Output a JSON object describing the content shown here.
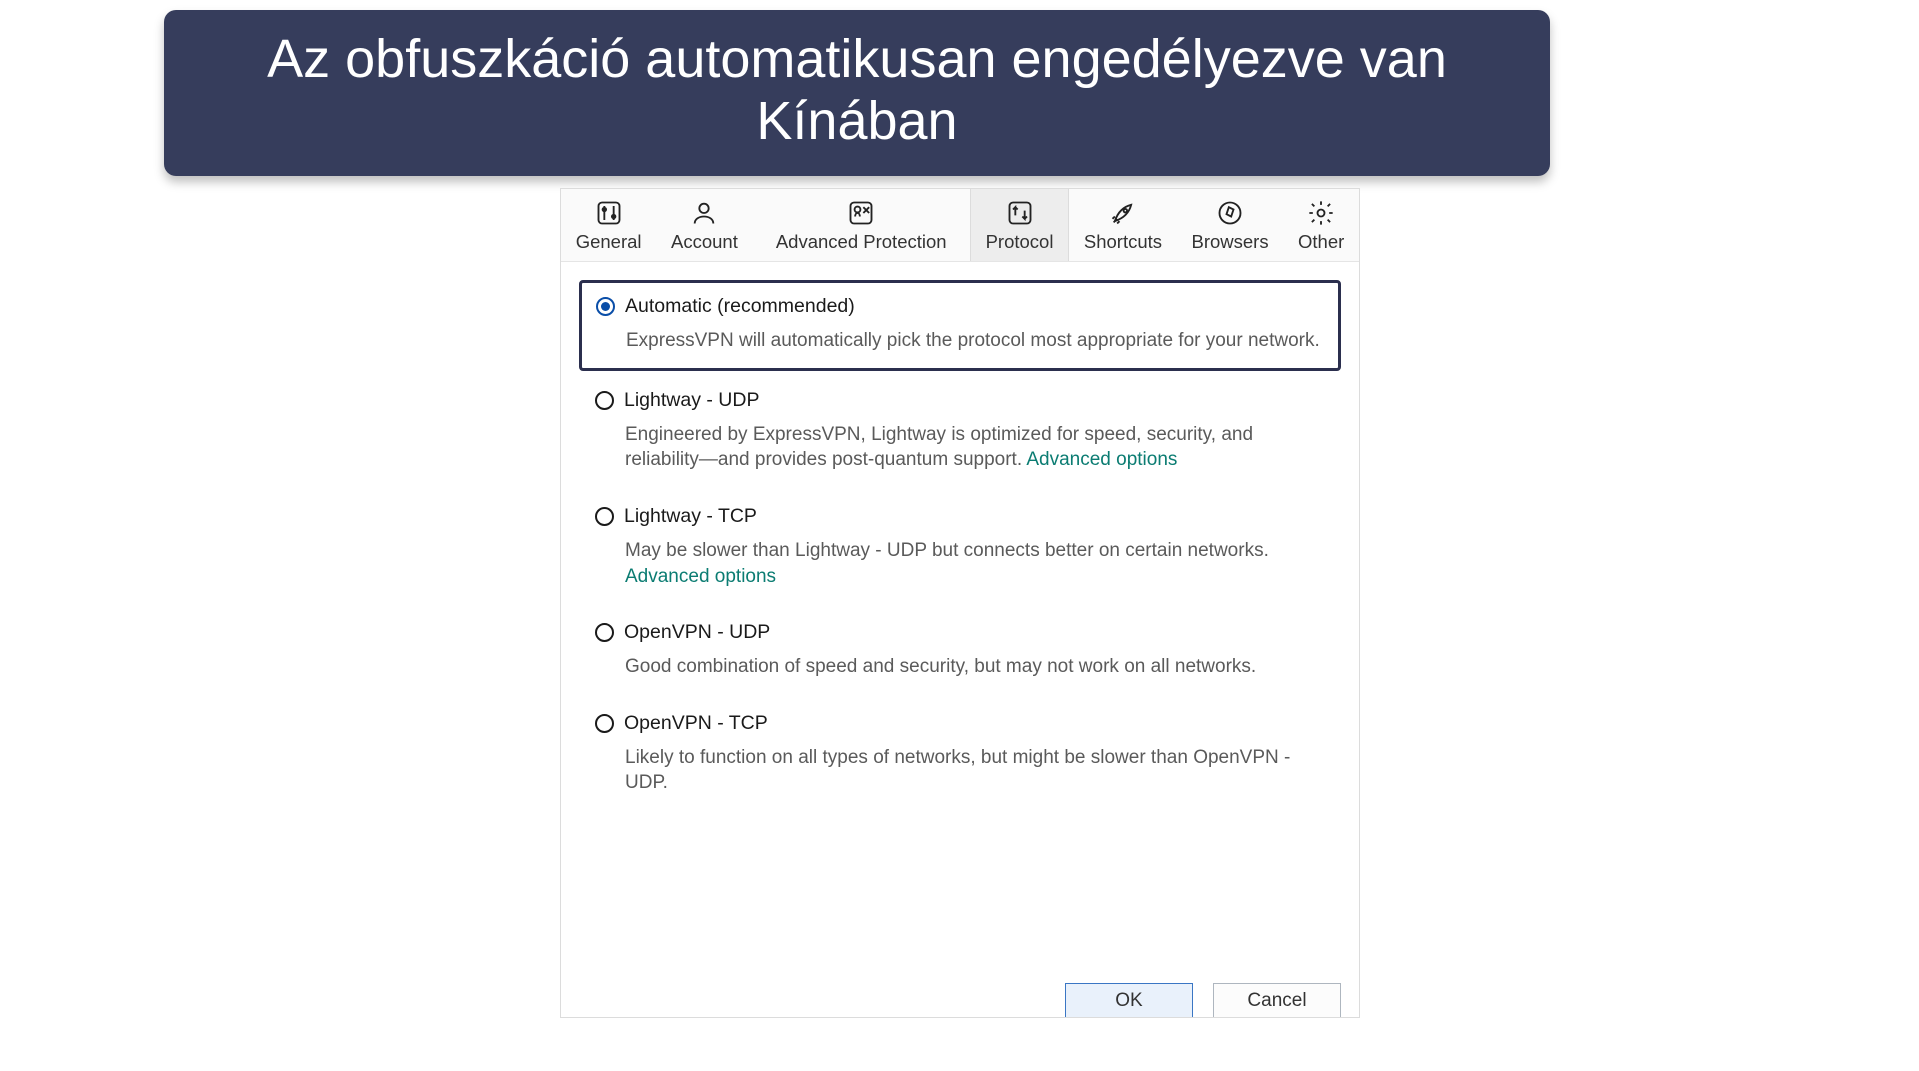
{
  "banner": {
    "text": "Az obfuszkáció automatikusan engedélyezve van Kínában"
  },
  "tabs": [
    {
      "id": "general",
      "label": "General"
    },
    {
      "id": "account",
      "label": "Account"
    },
    {
      "id": "advprot",
      "label": "Advanced Protection"
    },
    {
      "id": "protocol",
      "label": "Protocol",
      "active": true
    },
    {
      "id": "shortcuts",
      "label": "Shortcuts"
    },
    {
      "id": "browsers",
      "label": "Browsers"
    },
    {
      "id": "other",
      "label": "Other"
    }
  ],
  "protocols": {
    "automatic": {
      "title": "Automatic (recommended)",
      "desc": "ExpressVPN will automatically pick the protocol most appropriate for your network.",
      "selected": true
    },
    "lightway_udp": {
      "title": "Lightway - UDP",
      "desc_before": "Engineered by ExpressVPN, Lightway is optimized for speed, security, and reliability—and provides post-quantum support. ",
      "link": "Advanced options"
    },
    "lightway_tcp": {
      "title": "Lightway - TCP",
      "desc_before": "May be slower than Lightway - UDP but connects better on certain networks. ",
      "link": "Advanced options"
    },
    "openvpn_udp": {
      "title": "OpenVPN - UDP",
      "desc": "Good combination of speed and security, but may not work on all networks."
    },
    "openvpn_tcp": {
      "title": "OpenVPN - TCP",
      "desc": "Likely to function on all types of networks, but might be slower than OpenVPN - UDP."
    }
  },
  "buttons": {
    "ok": "OK",
    "cancel": "Cancel"
  }
}
